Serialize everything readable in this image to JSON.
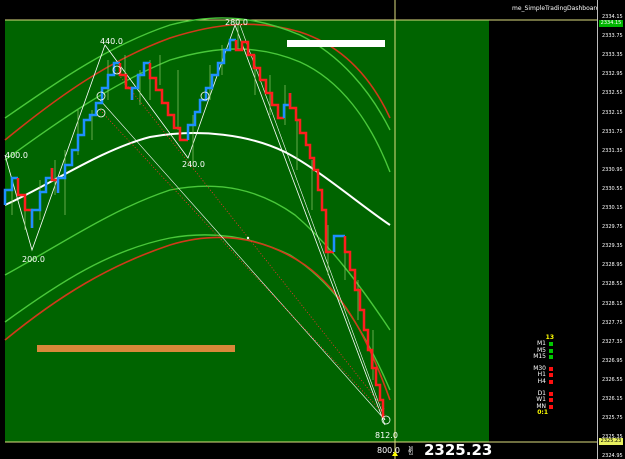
{
  "indicator": {
    "name": "me_SimpleTradingDashboard v1R",
    "icon": "info-circle-icon"
  },
  "price_axis": {
    "ticks": [
      "2334.15",
      "2333.75",
      "2333.35",
      "2332.95",
      "2332.55",
      "2332.15",
      "2331.75",
      "2331.35",
      "2330.95",
      "2330.55",
      "2330.15",
      "2329.75",
      "2329.35",
      "2328.95",
      "2328.55",
      "2328.15",
      "2327.75",
      "2327.35",
      "2326.95",
      "2326.55",
      "2326.15",
      "2325.75",
      "2325.35",
      "2324.95"
    ],
    "current_high_tag": "2334.15",
    "current_bid_tag": "2325.23"
  },
  "big_price": "2325.23",
  "wave_labels": [
    "440.0",
    "280.0",
    "400.0",
    "240.0",
    "200.0",
    "812.0",
    "800.0"
  ],
  "dashboard": {
    "header": "13",
    "groups": [
      [
        {
          "tf": "M1",
          "color": "#00c800"
        },
        {
          "tf": "M5",
          "color": "#00c800"
        },
        {
          "tf": "M15",
          "color": "#00c800"
        }
      ],
      [
        {
          "tf": "M30",
          "color": "#ff1010"
        },
        {
          "tf": "H1",
          "color": "#ff1010"
        },
        {
          "tf": "H4",
          "color": "#ff1010"
        }
      ],
      [
        {
          "tf": "D1",
          "color": "#ff1010"
        },
        {
          "tf": "W1",
          "color": "#ff1010"
        },
        {
          "tf": "MN",
          "color": "#ff1010"
        }
      ]
    ],
    "footer": "0:1"
  },
  "colors": {
    "chart_bg": "#006400",
    "bull": "#1e90ff",
    "bear": "#ff1e1e",
    "mid_band": "#ffffff",
    "outer_band": "#d03a1a",
    "inner_band": "#49c83a",
    "orange_rect": "#d8883a"
  }
}
